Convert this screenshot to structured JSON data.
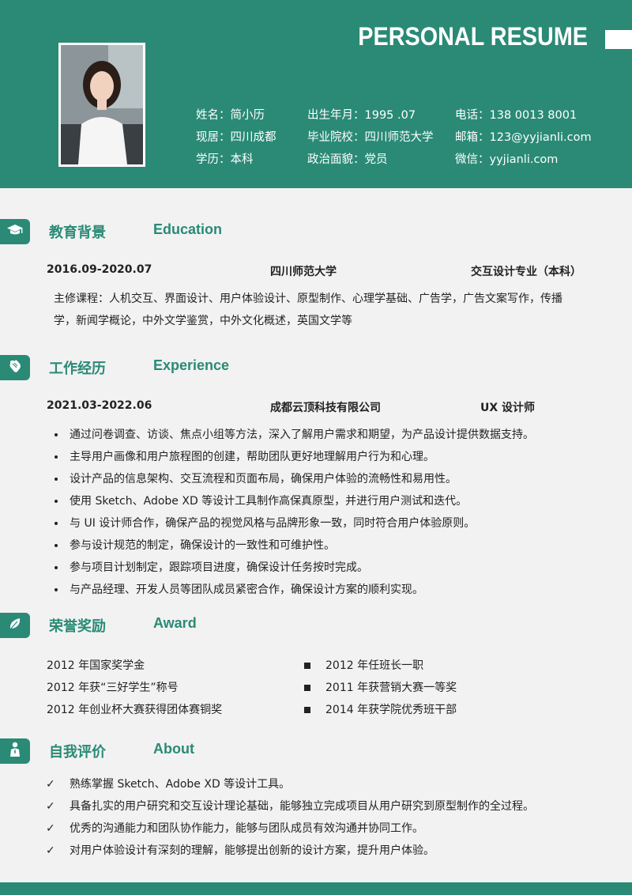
{
  "header": {
    "title": "PERSONAL RESUME",
    "info": [
      [
        "姓名：简小历",
        "出生年月：1995 .07",
        "电话：138 0013 8001"
      ],
      [
        "现居：四川成都",
        "毕业院校：四川师范大学",
        "邮箱：123@yyjianli.com"
      ],
      [
        "学历：本科",
        "政治面貌：党员",
        "微信：yyjianli.com"
      ]
    ]
  },
  "education": {
    "title_cn": "教育背景",
    "title_en": "Education",
    "period": "2016.09-2020.07",
    "school": "四川师范大学",
    "major": "交互设计专业（本科）",
    "courses_line1": "主修课程：人机交互、界面设计、用户体验设计、原型制作、心理学基础、广告学，广告文案写作，传播",
    "courses_line2": "学，新闻学概论，中外文学鉴赏，中外文化概述，英国文学等"
  },
  "experience": {
    "title_cn": "工作经历",
    "title_en": "Experience",
    "period": "2021.03-2022.06",
    "company": "成都云顶科技有限公司",
    "role": "UX 设计师",
    "items": [
      "通过问卷调查、访谈、焦点小组等方法，深入了解用户需求和期望，为产品设计提供数据支持。",
      "主导用户画像和用户旅程图的创建，帮助团队更好地理解用户行为和心理。",
      "设计产品的信息架构、交互流程和页面布局，确保用户体验的流畅性和易用性。",
      "使用 Sketch、Adobe XD 等设计工具制作高保真原型，并进行用户测试和迭代。",
      "与 UI 设计师合作，确保产品的视觉风格与品牌形象一致，同时符合用户体验原则。",
      "参与设计规范的制定，确保设计的一致性和可维护性。",
      "参与项目计划制定，跟踪项目进度，确保设计任务按时完成。",
      "与产品经理、开发人员等团队成员紧密合作，确保设计方案的顺利实现。"
    ]
  },
  "award": {
    "title_cn": "荣誉奖励",
    "title_en": "Award",
    "left": [
      "2012 年国家奖学金",
      "2012 年获“三好学生”称号",
      "2012 年创业杯大赛获得团体赛铜奖"
    ],
    "right": [
      "2012 年任班长一职",
      "2011 年获营销大赛一等奖",
      "2014 年获学院优秀班干部"
    ]
  },
  "about": {
    "title_cn": "自我评价",
    "title_en": "About",
    "items": [
      "熟练掌握 Sketch、Adobe XD 等设计工具。",
      "具备扎实的用户研究和交互设计理论基础，能够独立完成项目从用户研究到原型制作的全过程。",
      "优秀的沟通能力和团队协作能力，能够与团队成员有效沟通并协同工作。",
      "对用户体验设计有深刻的理解，能够提出创新的设计方案，提升用户体验。"
    ]
  },
  "colors": {
    "accent": "#2a8a76",
    "background": "#f2f2f2"
  },
  "icons": [
    "graduation-cap-icon",
    "hand-icon",
    "leaf-icon",
    "person-icon"
  ]
}
